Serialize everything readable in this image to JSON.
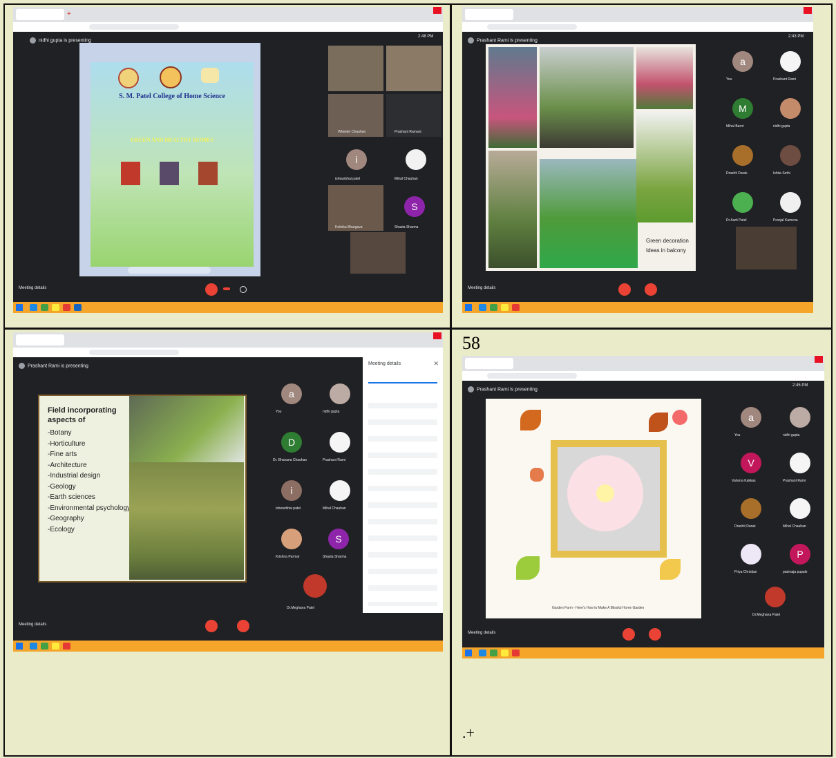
{
  "cells": [
    {
      "presenter": "nidhi gupta is presenting",
      "time": "2:48 PM",
      "poster": {
        "college": "S. M. Patel College of Home Science",
        "event": "GREEN AND HEALTHY HOMES"
      },
      "participants": [
        "Wheeler Chauhan",
        "Prashant Ramani",
        "ishwarbhai patel",
        "Mihal Chauhan",
        "Kotinka Bhargava",
        "Shasta Sharma"
      ],
      "avatars": [
        "i",
        "S"
      ],
      "meeting_details": "Meeting details"
    },
    {
      "presenter": "Prashant Rami is presenting",
      "time": "2:43 PM",
      "slide_caption_1": "Green decoration",
      "slide_caption_2": "Ideas in balcony",
      "avatars": [
        "a",
        "M"
      ],
      "participants": [
        "You",
        "Prashant Rami",
        "Mihal Barot",
        "nidhi gupta",
        "Drashti Darak",
        "Ishita Sethi",
        "Dr Aarti Patel",
        "Pranjal Kamena"
      ],
      "meeting_details": "Meeting details"
    },
    {
      "presenter": "Prashant Rami is presenting",
      "slide_title": "Field incorporating aspects of",
      "slide_items": [
        "-Botany",
        "-Horticulture",
        "-Fine arts",
        "-Architecture",
        "-Industrial design",
        "-Geology",
        "-Earth sciences",
        "-Environmental psychology",
        "-Geography",
        "-Ecology"
      ],
      "avatars": [
        "a",
        "D",
        "i",
        "S"
      ],
      "participants": [
        "You",
        "nidhi gupta",
        "Dr. Bhavana Chauhan",
        "Prashant Rami",
        "ishwarbhai patel",
        "Mihal Chauhan",
        "Krishna Parmar",
        "Shasta Sharma",
        "Dr.Meghana Patel"
      ],
      "panel_title": "Meeting details",
      "meeting_details": "Meeting details"
    },
    {
      "page_number": "58",
      "presenter": "Prashant Rami is presenting",
      "time": "2:45 PM",
      "slide_footer": "Garden Farm - Here's How to Make A Blissful Home Garden",
      "avatars": [
        "a",
        "V",
        "P"
      ],
      "participants": [
        "You",
        "nidhi gupta",
        "Vahona Kakkas",
        "Prashant Rami",
        "Drashti Darak",
        "Mihal Chauhan",
        "Priya Christian",
        "padmaja pupale",
        "Dr.Meghana Patel"
      ],
      "meeting_details": "Meeting details",
      "trailing_text": ".+"
    }
  ],
  "colors": {
    "page_bg": "#eaecc9",
    "meet_bg": "#202124",
    "end_call": "#ea4335",
    "taskbar": "#f4a52a"
  }
}
